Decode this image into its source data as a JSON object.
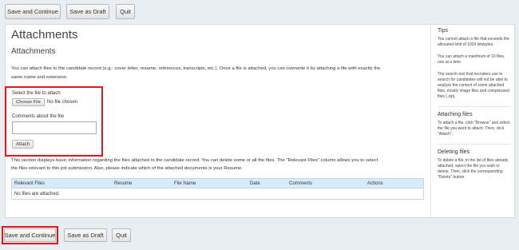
{
  "top_toolbar": {
    "save_continue": "Save and Continue",
    "save_draft": "Save as Draft",
    "quit": "Quit"
  },
  "page": {
    "title": "Attachments",
    "subtitle": "Attachments",
    "intro_line1": "You can attach files to the candidate record (e.g.: cover letter, resume, references, transcripts, etc.). Once a file is attached, you can overwrite it by attaching a file with exactly the",
    "intro_line2": "same name and extension."
  },
  "attach_form": {
    "select_label": "Select the file to attach",
    "choose_file": "Choose File",
    "no_file": "No file chosen",
    "comments_label": "Comments about the file",
    "comments_value": "",
    "attach_button": "Attach"
  },
  "section_text": {
    "line1": "This section displays basic information regarding the files attached to the candidate record. You can delete some or all the files. The \"Relevant Files\" column allows you to select",
    "line2": "the files relevant to this job submission. Also, please indicate which of the attached documents is your Resume."
  },
  "table": {
    "columns": [
      "Relevant Files",
      "Resume",
      "File Name",
      "Date",
      "Comments",
      "Actions"
    ],
    "empty_message": "No files are attached."
  },
  "sidebar": {
    "tips_title": "Tips",
    "tip1": "You cannot attach a file that exceeds the allocated limit of 1024 kilobytes.",
    "tip2": "You can attach a maximum of 10 files, one at a time.",
    "tip3": "The search tool that recruiters use to search for candidates will not be able to analyze the content of some attached files, mostly image files and compressed files (.zip).",
    "attaching_title": "Attaching files",
    "attaching_text": "To attach a file, click \"Browse\" and select the file you want to attach. Then, click \"Attach\".",
    "deleting_title": "Deleting files",
    "deleting_text": "To delete a file, in the list of files already attached, select the file you wish to delete. Then, click the corresponding \"Delete\" button."
  },
  "bottom_toolbar": {
    "save_continue": "Save and Continue",
    "save_draft": "Save as Draft",
    "quit": "Quit"
  },
  "colors": {
    "highlight": "#e8161c",
    "table_header": "#d9ebf9",
    "background": "#e9eef3"
  }
}
